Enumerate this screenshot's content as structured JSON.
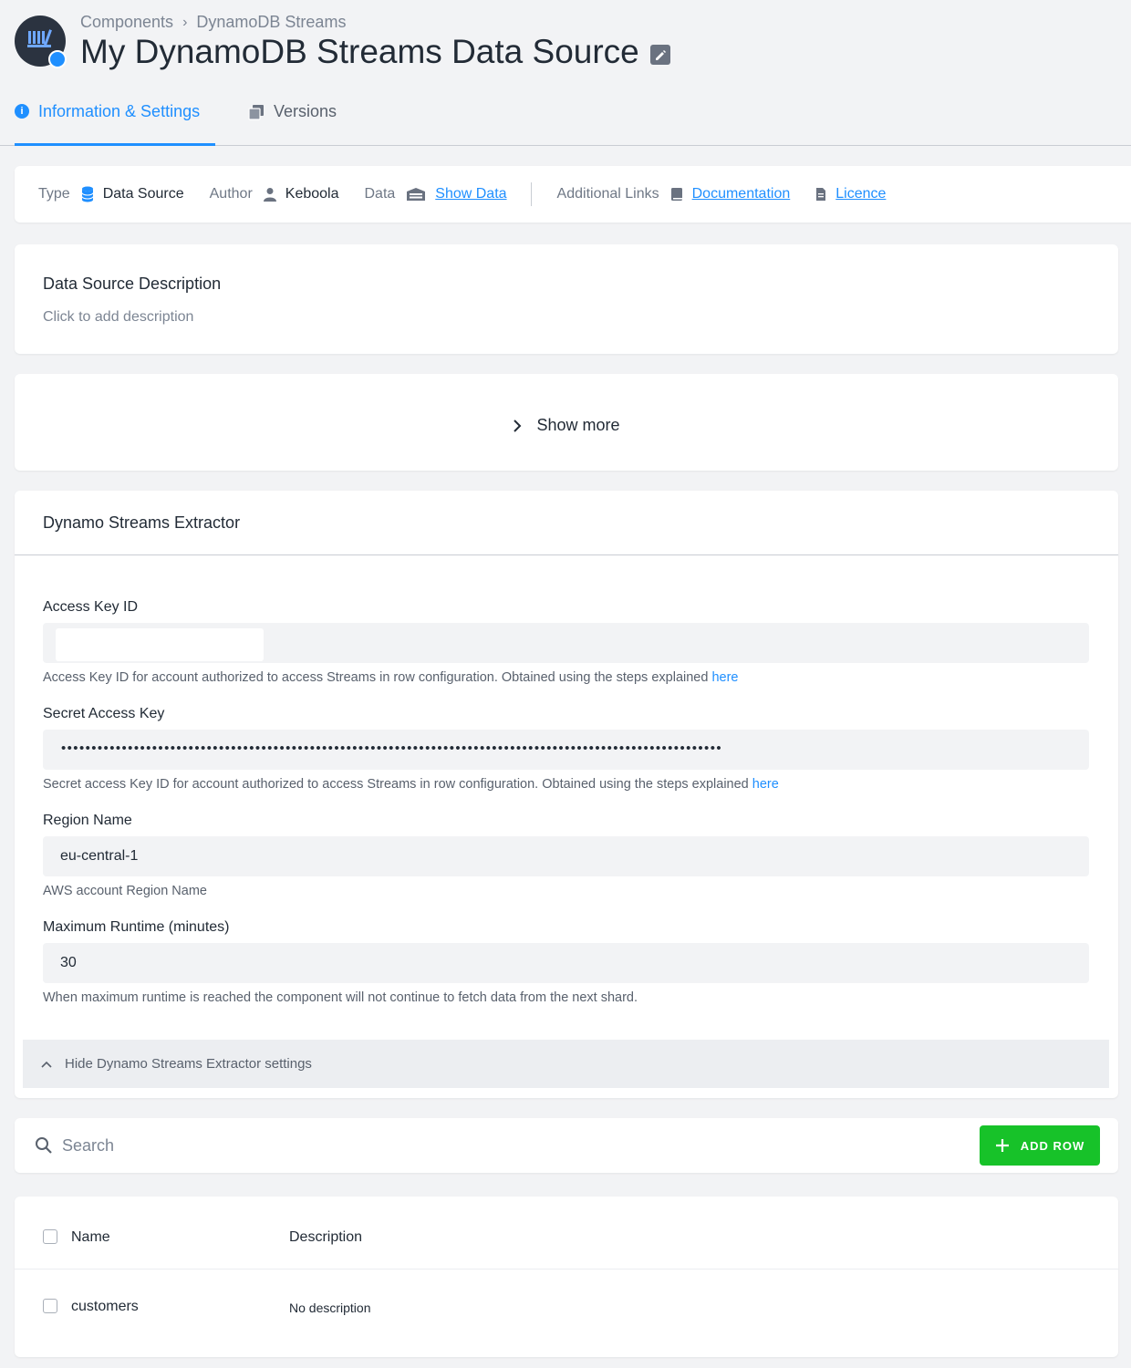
{
  "breadcrumb": {
    "parent": "Components",
    "current": "DynamoDB Streams"
  },
  "page": {
    "title": "My DynamoDB Streams Data Source"
  },
  "tabs": [
    {
      "label": "Information & Settings",
      "active": true
    },
    {
      "label": "Versions",
      "active": false
    }
  ],
  "info_bar": {
    "type_label": "Type",
    "type_value": "Data Source",
    "author_label": "Author",
    "author_value": "Keboola",
    "data_label": "Data",
    "data_link": "Show Data",
    "links_label": "Additional Links",
    "documentation_link": "Documentation",
    "licence_link": "Licence"
  },
  "description": {
    "title": "Data Source Description",
    "placeholder": "Click to add description"
  },
  "show_more": {
    "label": "Show more"
  },
  "extractor": {
    "title": "Dynamo Streams Extractor",
    "access_key": {
      "label": "Access Key ID",
      "value": "",
      "help": "Access Key ID for account authorized to access Streams in row configuration. Obtained using the steps explained ",
      "help_link": "here"
    },
    "secret_key": {
      "label": "Secret Access Key",
      "value": "•••••••••••••••••••••••••••••••••••••••••••••••••••••••••••••••••••••••••••••••••••••••••••••••••••••••••••••",
      "help": "Secret access Key ID for account authorized to access Streams in row configuration. Obtained using the steps explained ",
      "help_link": "here"
    },
    "region": {
      "label": "Region Name",
      "value": "eu-central-1",
      "help": "AWS account Region Name"
    },
    "runtime": {
      "label": "Maximum Runtime (minutes)",
      "value": "30",
      "help": "When maximum runtime is reached the component will not continue to fetch data from the next shard."
    },
    "hide_label": "Hide Dynamo Streams Extractor settings"
  },
  "search": {
    "placeholder": "Search"
  },
  "add_row": {
    "label": "ADD ROW"
  },
  "table": {
    "headers": {
      "name": "Name",
      "description": "Description"
    },
    "rows": [
      {
        "name": "customers",
        "description": "No description"
      }
    ]
  },
  "colors": {
    "accent": "#1f8fff",
    "success": "#17c229",
    "background": "#f2f3f5"
  }
}
